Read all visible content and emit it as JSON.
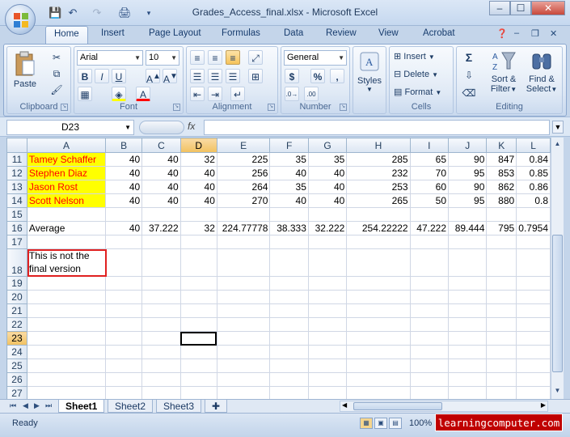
{
  "window": {
    "title": "Grades_Access_final.xlsx - Microsoft Excel",
    "controls": [
      "–",
      "☐",
      "✕"
    ]
  },
  "ribbon": {
    "tabs": [
      "Home",
      "Insert",
      "Page Layout",
      "Formulas",
      "Data",
      "Review",
      "View",
      "Acrobat"
    ],
    "active_tab": "Home",
    "clipboard": {
      "label": "Clipboard",
      "paste": "Paste"
    },
    "font": {
      "label": "Font",
      "family": "Arial",
      "size": "10"
    },
    "alignment": {
      "label": "Alignment"
    },
    "number": {
      "label": "Number",
      "format": "General",
      "currency": "$",
      "percent": "%",
      "comma": ","
    },
    "styles": {
      "label": "Styles"
    },
    "cells": {
      "label": "Cells",
      "insert": "Insert",
      "delete": "Delete",
      "format": "Format"
    },
    "editing": {
      "label": "Editing",
      "sort": "Sort &",
      "filter": "Filter",
      "find": "Find &",
      "select": "Select"
    }
  },
  "formula_bar": {
    "name_box": "D23",
    "fx": "fx",
    "value": ""
  },
  "columns": [
    "A",
    "B",
    "C",
    "D",
    "E",
    "F",
    "G",
    "H",
    "I",
    "J",
    "K",
    "L"
  ],
  "selected_column": "D",
  "selected_row": 23,
  "rows": [
    {
      "n": "11",
      "cells": [
        "Tamey Schaffer",
        "40",
        "40",
        "32",
        "225",
        "35",
        "35",
        "285",
        "65",
        "90",
        "847",
        "0.84"
      ],
      "highlight": true
    },
    {
      "n": "12",
      "cells": [
        "Stephen Diaz",
        "40",
        "40",
        "40",
        "256",
        "40",
        "40",
        "232",
        "70",
        "95",
        "853",
        "0.85"
      ],
      "highlight": true
    },
    {
      "n": "13",
      "cells": [
        "Jason Rost",
        "40",
        "40",
        "40",
        "264",
        "35",
        "40",
        "253",
        "60",
        "90",
        "862",
        "0.86"
      ],
      "highlight": true
    },
    {
      "n": "14",
      "cells": [
        "Scott Nelson",
        "40",
        "40",
        "40",
        "270",
        "40",
        "40",
        "265",
        "50",
        "95",
        "880",
        "0.8"
      ],
      "highlight": true
    },
    {
      "n": "15",
      "cells": [
        "",
        "",
        "",
        "",
        "",
        "",
        "",
        "",
        "",
        "",
        "",
        ""
      ]
    },
    {
      "n": "16",
      "cells": [
        "Average",
        "40",
        "37.222",
        "32",
        "224.77778",
        "38.333",
        "32.222",
        "254.22222",
        "47.222",
        "89.444",
        "795",
        "0.7954"
      ]
    },
    {
      "n": "17",
      "cells": [
        "",
        "",
        "",
        "",
        "",
        "",
        "",
        "",
        "",
        "",
        "",
        ""
      ]
    },
    {
      "n": "18",
      "cells": [
        "This is not the final version",
        "",
        "",
        "",
        "",
        "",
        "",
        "",
        "",
        "",
        "",
        ""
      ],
      "note": true
    },
    {
      "n": "19",
      "cells": [
        "",
        "",
        "",
        "",
        "",
        "",
        "",
        "",
        "",
        "",
        "",
        ""
      ]
    },
    {
      "n": "20",
      "cells": [
        "",
        "",
        "",
        "",
        "",
        "",
        "",
        "",
        "",
        "",
        "",
        ""
      ]
    },
    {
      "n": "21",
      "cells": [
        "",
        "",
        "",
        "",
        "",
        "",
        "",
        "",
        "",
        "",
        "",
        ""
      ]
    },
    {
      "n": "22",
      "cells": [
        "",
        "",
        "",
        "",
        "",
        "",
        "",
        "",
        "",
        "",
        "",
        ""
      ]
    },
    {
      "n": "23",
      "cells": [
        "",
        "",
        "",
        "",
        "",
        "",
        "",
        "",
        "",
        "",
        "",
        ""
      ]
    },
    {
      "n": "24",
      "cells": [
        "",
        "",
        "",
        "",
        "",
        "",
        "",
        "",
        "",
        "",
        "",
        ""
      ]
    },
    {
      "n": "25",
      "cells": [
        "",
        "",
        "",
        "",
        "",
        "",
        "",
        "",
        "",
        "",
        "",
        ""
      ]
    },
    {
      "n": "26",
      "cells": [
        "",
        "",
        "",
        "",
        "",
        "",
        "",
        "",
        "",
        "",
        "",
        ""
      ]
    },
    {
      "n": "27",
      "cells": [
        "",
        "",
        "",
        "",
        "",
        "",
        "",
        "",
        "",
        "",
        "",
        ""
      ]
    }
  ],
  "sheets": [
    "Sheet1",
    "Sheet2",
    "Sheet3"
  ],
  "active_sheet": "Sheet1",
  "status": {
    "text": "Ready",
    "zoom": "100%"
  },
  "watermark": "learningcomputer.com",
  "colors": {
    "highlight_fill": "#ffff00",
    "highlight_text": "#ff0000",
    "note_border": "#e02020",
    "selection": "#f1c15f"
  }
}
